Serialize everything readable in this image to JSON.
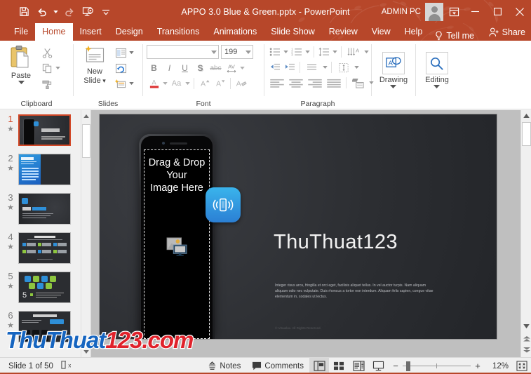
{
  "titlebar": {
    "quick_access": [
      {
        "name": "save-icon",
        "tooltip": "Save"
      },
      {
        "name": "undo-icon",
        "tooltip": "Undo"
      },
      {
        "name": "redo-icon",
        "tooltip": "Redo"
      },
      {
        "name": "start-presentation-icon",
        "tooltip": "Start From Beginning"
      },
      {
        "name": "customize-qat-icon",
        "tooltip": "Customize Quick Access Toolbar"
      }
    ],
    "document_name": "APPO 3.0 Blue & Green.pptx",
    "separator": "-",
    "app_name": "PowerPoint",
    "account_name": "ADMIN PC",
    "ribbon_display_tooltip": "Ribbon Display Options",
    "minimize": "─",
    "maximize": "☐",
    "close": "✕"
  },
  "tabs": [
    {
      "label": "File",
      "active": false
    },
    {
      "label": "Home",
      "active": true
    },
    {
      "label": "Insert",
      "active": false
    },
    {
      "label": "Design",
      "active": false
    },
    {
      "label": "Transitions",
      "active": false
    },
    {
      "label": "Animations",
      "active": false
    },
    {
      "label": "Slide Show",
      "active": false
    },
    {
      "label": "Review",
      "active": false
    },
    {
      "label": "View",
      "active": false
    },
    {
      "label": "Help",
      "active": false
    }
  ],
  "tellme": {
    "label": "Tell me",
    "icon": "lightbulb-icon"
  },
  "share": {
    "label": "Share",
    "icon": "share-person-icon"
  },
  "ribbon": {
    "clipboard": {
      "label": "Clipboard",
      "paste_label": "Paste",
      "buttons": [
        {
          "name": "cut-icon",
          "label": "Cut"
        },
        {
          "name": "copy-icon",
          "label": "Copy"
        },
        {
          "name": "format-painter-icon",
          "label": "Format Painter"
        }
      ]
    },
    "slides": {
      "label": "Slides",
      "new_slide_label": "New\nSlide",
      "new_slide_line1": "New",
      "new_slide_line2": "Slide",
      "buttons": [
        {
          "name": "layout-icon",
          "label": "Layout"
        },
        {
          "name": "reset-icon",
          "label": "Reset"
        },
        {
          "name": "section-icon",
          "label": "Section"
        }
      ]
    },
    "font": {
      "label": "Font",
      "font_name_value": "",
      "font_name_placeholder": "",
      "font_size_value": "199",
      "bold": "B",
      "italic": "I",
      "underline": "U",
      "shadow": "S",
      "strikethrough": "abc",
      "char_spacing": "AV",
      "font_color": "A",
      "change_case": "Aa",
      "increase_size": "A",
      "decrease_size": "A",
      "clear_formatting": "A"
    },
    "paragraph": {
      "label": "Paragraph",
      "buttons": [
        {
          "name": "bullets-icon",
          "label": "Bullets"
        },
        {
          "name": "numbering-icon",
          "label": "Numbering"
        },
        {
          "name": "line-spacing-icon",
          "label": "Line Spacing"
        },
        {
          "name": "text-direction-icon",
          "label": "Text Direction"
        },
        {
          "name": "decrease-indent-icon",
          "label": "Decrease List Level"
        },
        {
          "name": "increase-indent-icon",
          "label": "Increase List Level"
        },
        {
          "name": "columns-icon",
          "label": "Columns"
        },
        {
          "name": "align-text-icon",
          "label": "Align Text"
        },
        {
          "name": "align-left-icon",
          "label": "Align Left"
        },
        {
          "name": "align-center-icon",
          "label": "Center"
        },
        {
          "name": "align-right-icon",
          "label": "Align Right"
        },
        {
          "name": "justify-icon",
          "label": "Justify"
        },
        {
          "name": "smartart-icon",
          "label": "Convert to SmartArt"
        }
      ]
    },
    "drawing": {
      "label": "Drawing",
      "icon": "drawing-shapes-icon"
    },
    "editing": {
      "label": "Editing",
      "icon": "magnifier-icon"
    }
  },
  "thumbnails": {
    "items": [
      {
        "number": "1",
        "selected": true,
        "animated": true
      },
      {
        "number": "2",
        "selected": false,
        "animated": true
      },
      {
        "number": "3",
        "selected": false,
        "animated": true
      },
      {
        "number": "4",
        "selected": false,
        "animated": true
      },
      {
        "number": "5",
        "selected": false,
        "animated": true
      },
      {
        "number": "6",
        "selected": false,
        "animated": true
      }
    ],
    "star_glyph": "★"
  },
  "slide": {
    "placeholder_text_line1": "Drag & Drop Your",
    "placeholder_text_line2": "Image Here",
    "title": "ThuThuat123",
    "body": "Integer risus arcu, fringilla et orci eget, facilisis aliquet tellus. In vel auctor turpis. Nam aliquam aliquam odio nec vulputate. Duis rhoncus a tortor non interdum. Aliquam felis sapien, congue vitae elementum in, sodales ut lectus.",
    "copyright": "© Visualux. All Rights Reserved.",
    "app_icon_name": "vibrating-phone-icon",
    "image_placeholder_icon": "picture-placeholder-icon"
  },
  "watermark": {
    "part1": "ThuThuat",
    "part2": "123.com"
  },
  "statusbar": {
    "slide_indicator": "Slide 1 of 50",
    "accessibility_icon": "accessibility-check-icon",
    "notes_label": "Notes",
    "comments_label": "Comments",
    "views": [
      {
        "name": "normal-view-icon",
        "label": "Normal",
        "active": true
      },
      {
        "name": "slide-sorter-icon",
        "label": "Slide Sorter",
        "active": false
      },
      {
        "name": "reading-view-icon",
        "label": "Reading View",
        "active": false
      },
      {
        "name": "slide-show-icon",
        "label": "Slide Show",
        "active": false
      }
    ],
    "zoom_out": "−",
    "zoom_in": "+",
    "zoom_level": "12%",
    "fit_label": "Fit slide to current window"
  },
  "colors": {
    "accent": "#b7472a",
    "tab_active_text": "#b7472a",
    "selection": "#d24726",
    "slide_bg": "#2f3135",
    "app_icon_blue": "#2b7fd4",
    "watermark_blue": "#1665c0",
    "watermark_red": "#e0222b"
  }
}
